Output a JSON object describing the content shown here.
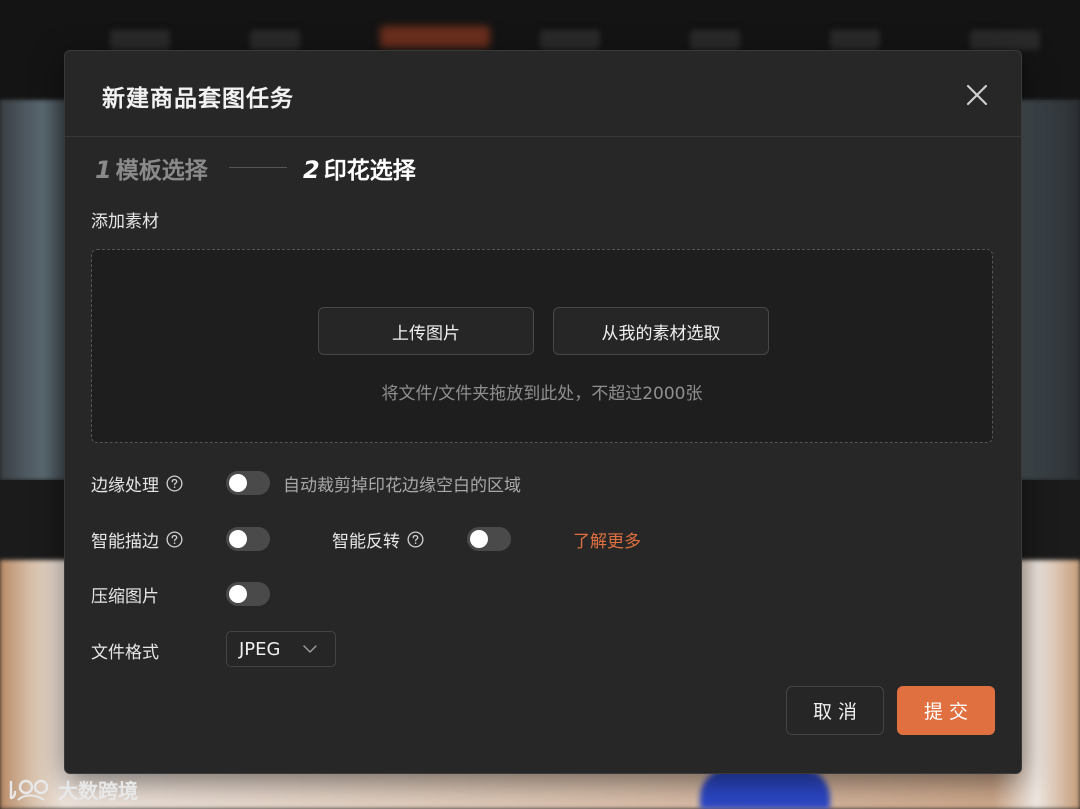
{
  "dialog": {
    "title": "新建商品套图任务"
  },
  "steps": [
    {
      "number": "1",
      "label": "模板选择",
      "state": "done"
    },
    {
      "number": "2",
      "label": "印花选择",
      "state": "active"
    }
  ],
  "add_material": {
    "label": "添加素材",
    "upload_button": "上传图片",
    "library_button": "从我的素材选取",
    "hint": "将文件/文件夹拖放到此处，不超过2000张"
  },
  "options": {
    "edge": {
      "label": "边缘处理",
      "enabled": false,
      "description": "自动裁剪掉印花边缘空白的区域"
    },
    "stroke": {
      "label": "智能描边",
      "enabled": false
    },
    "invert": {
      "label": "智能反转",
      "enabled": false
    },
    "learn_more": "了解更多",
    "compress": {
      "label": "压缩图片",
      "enabled": false
    },
    "format": {
      "label": "文件格式",
      "value": "JPEG"
    }
  },
  "footer": {
    "cancel": "取消",
    "submit": "提交"
  },
  "watermark": {
    "text": "大数跨境"
  },
  "colors": {
    "accent": "#e0703f",
    "modal_bg": "#272727",
    "toggle_off": "#4a4a4a"
  }
}
